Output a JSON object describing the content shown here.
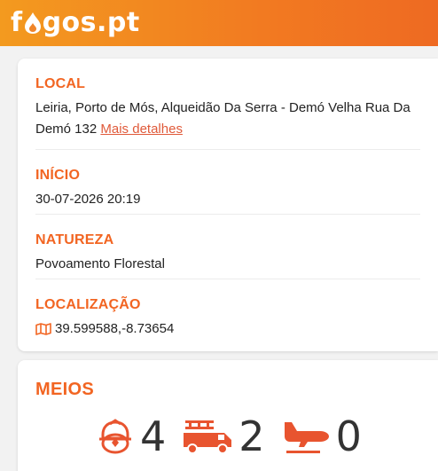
{
  "app": {
    "logo_text_1": "f",
    "logo_text_2": "gos.pt"
  },
  "colors": {
    "accent": "#f26522",
    "link": "#e05a3a",
    "header_start": "#f39a1f",
    "header_end": "#ee6a22"
  },
  "info": {
    "local_label": "LOCAL",
    "local_value": "Leiria, Porto de Mós, Alqueidão Da Serra - Demó Velha Rua Da Demó 132",
    "details_link": "Mais detalhes",
    "inicio_label": "INÍCIO",
    "inicio_value": "30-07-2026 20:19",
    "natureza_label": "NATUREZA",
    "natureza_value": "Povoamento Florestal",
    "localizacao_label": "LOCALIZAÇÃO",
    "localizacao_icon": "map-icon",
    "localizacao_value": "39.599588,-8.73654"
  },
  "meios": {
    "title": "MEIOS",
    "items": [
      {
        "icon": "firefighter-helmet-icon",
        "count": "4"
      },
      {
        "icon": "fire-truck-icon",
        "count": "2"
      },
      {
        "icon": "airplane-icon",
        "count": "0"
      }
    ]
  }
}
